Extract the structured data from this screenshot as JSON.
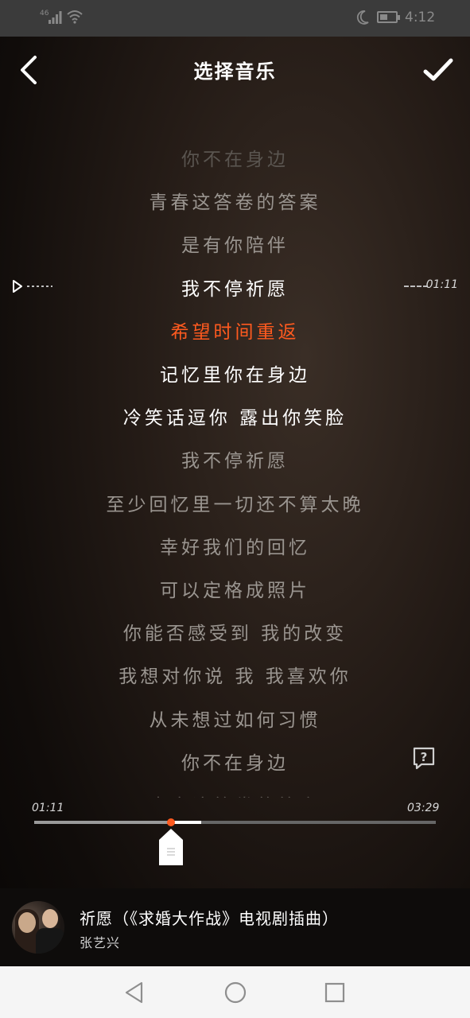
{
  "status_bar": {
    "signal_label": "46",
    "time": "4:12"
  },
  "header": {
    "title": "选择音乐",
    "back_icon": "chevron-left-icon",
    "confirm_icon": "checkmark-icon"
  },
  "lyrics": {
    "lines": [
      {
        "text": "你不在身边",
        "state": "faded"
      },
      {
        "text": "青春这答卷的答案",
        "state": "normal"
      },
      {
        "text": "是有你陪伴",
        "state": "normal"
      },
      {
        "text": "我不停祈愿",
        "state": "bright"
      },
      {
        "text": "希望时间重返",
        "state": "current"
      },
      {
        "text": "记忆里你在身边",
        "state": "bright"
      },
      {
        "text": "冷笑话逗你 露出你笑脸",
        "state": "bright"
      },
      {
        "text": "我不停祈愿",
        "state": "normal"
      },
      {
        "text": "至少回忆里一切还不算太晚",
        "state": "normal"
      },
      {
        "text": "幸好我们的回忆",
        "state": "normal"
      },
      {
        "text": "可以定格成照片",
        "state": "normal"
      },
      {
        "text": "你能否感受到 我的改变",
        "state": "normal"
      },
      {
        "text": "我想对你说 我 我喜欢你",
        "state": "normal"
      },
      {
        "text": "从未想过如何习惯",
        "state": "normal"
      },
      {
        "text": "你不在身边",
        "state": "normal"
      },
      {
        "text": "青春这答卷的答案",
        "state": "cut"
      }
    ],
    "selection_time": "01:11"
  },
  "progress": {
    "start_time": "01:11",
    "end_time": "03:29",
    "played_fraction": 0.34,
    "selected_end_fraction": 0.415
  },
  "now_playing": {
    "title": "祈愿（《求婚大作战》电视剧插曲）",
    "artist": "张艺兴"
  },
  "colors": {
    "accent": "#ff5a1f",
    "status_bar_bg": "#3b3b3b",
    "nav_bar_bg": "#f5f5f5"
  }
}
